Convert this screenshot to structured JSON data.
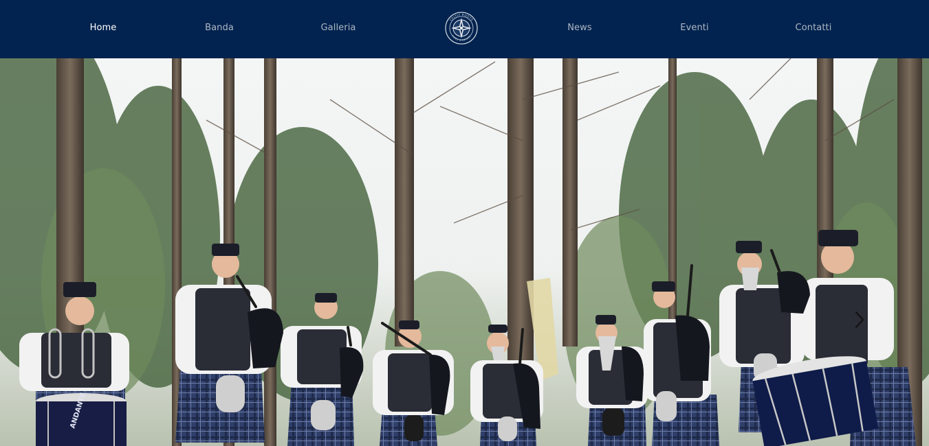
{
  "nav": {
    "items": [
      {
        "label": "Home",
        "active": true
      },
      {
        "label": "Banda",
        "active": false
      },
      {
        "label": "Galleria",
        "active": false
      },
      {
        "label": "News",
        "active": false
      },
      {
        "label": "Eventi",
        "active": false
      },
      {
        "label": "Contatti",
        "active": false
      }
    ],
    "logo_text_top": "CELTIC ROOTS",
    "logo_text_bottom": "PIPES & DRUMS"
  },
  "hero": {
    "image": "pipe-band-in-forest-photo",
    "drum_brand": "ANDANTE",
    "next_icon": "chevron-right-icon"
  },
  "colors": {
    "navbar": "#02234f",
    "nav_text": "#aeb7c5",
    "nav_active": "#ffffff"
  }
}
